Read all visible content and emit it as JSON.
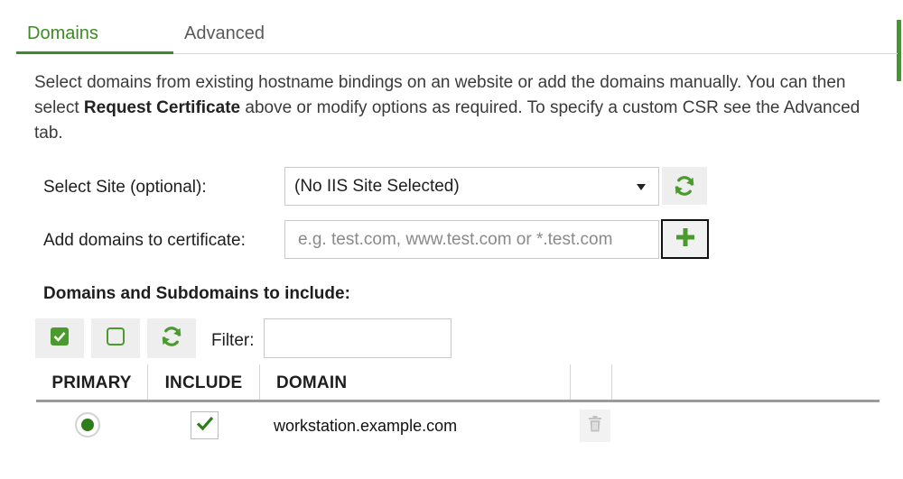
{
  "tabs": [
    {
      "label": "Domains",
      "active": true
    },
    {
      "label": "Advanced",
      "active": false
    }
  ],
  "description": {
    "part1": "Select domains from existing hostname bindings on an website or add the domains manually. You can then select ",
    "bold": "Request Certificate",
    "part2": " above or modify options as required. To specify a custom CSR see the Advanced tab."
  },
  "site": {
    "label": "Select Site (optional):",
    "selected": "(No IIS Site Selected)",
    "refresh_icon": "refresh-icon"
  },
  "add_domains": {
    "label": "Add domains to certificate:",
    "placeholder": "e.g. test.com, www.test.com or *.test.com",
    "value": "",
    "add_icon": "plus-icon"
  },
  "domains_section": {
    "title": "Domains and Subdomains to include:",
    "filter_label": "Filter:",
    "filter_value": "",
    "tool_icons": [
      "select-all-checkbox-icon",
      "select-none-checkbox-icon",
      "refresh-icon"
    ]
  },
  "grid": {
    "columns": [
      "PRIMARY",
      "INCLUDE",
      "DOMAIN"
    ],
    "rows": [
      {
        "primary": true,
        "include": true,
        "domain": "workstation.example.com",
        "delete_icon": "trash-icon"
      }
    ]
  },
  "colors": {
    "accent": "#3c8b26",
    "icon_green": "#4a9a2e",
    "button_bg": "#eeeeee",
    "disabled_icon": "#c3c3c3"
  }
}
